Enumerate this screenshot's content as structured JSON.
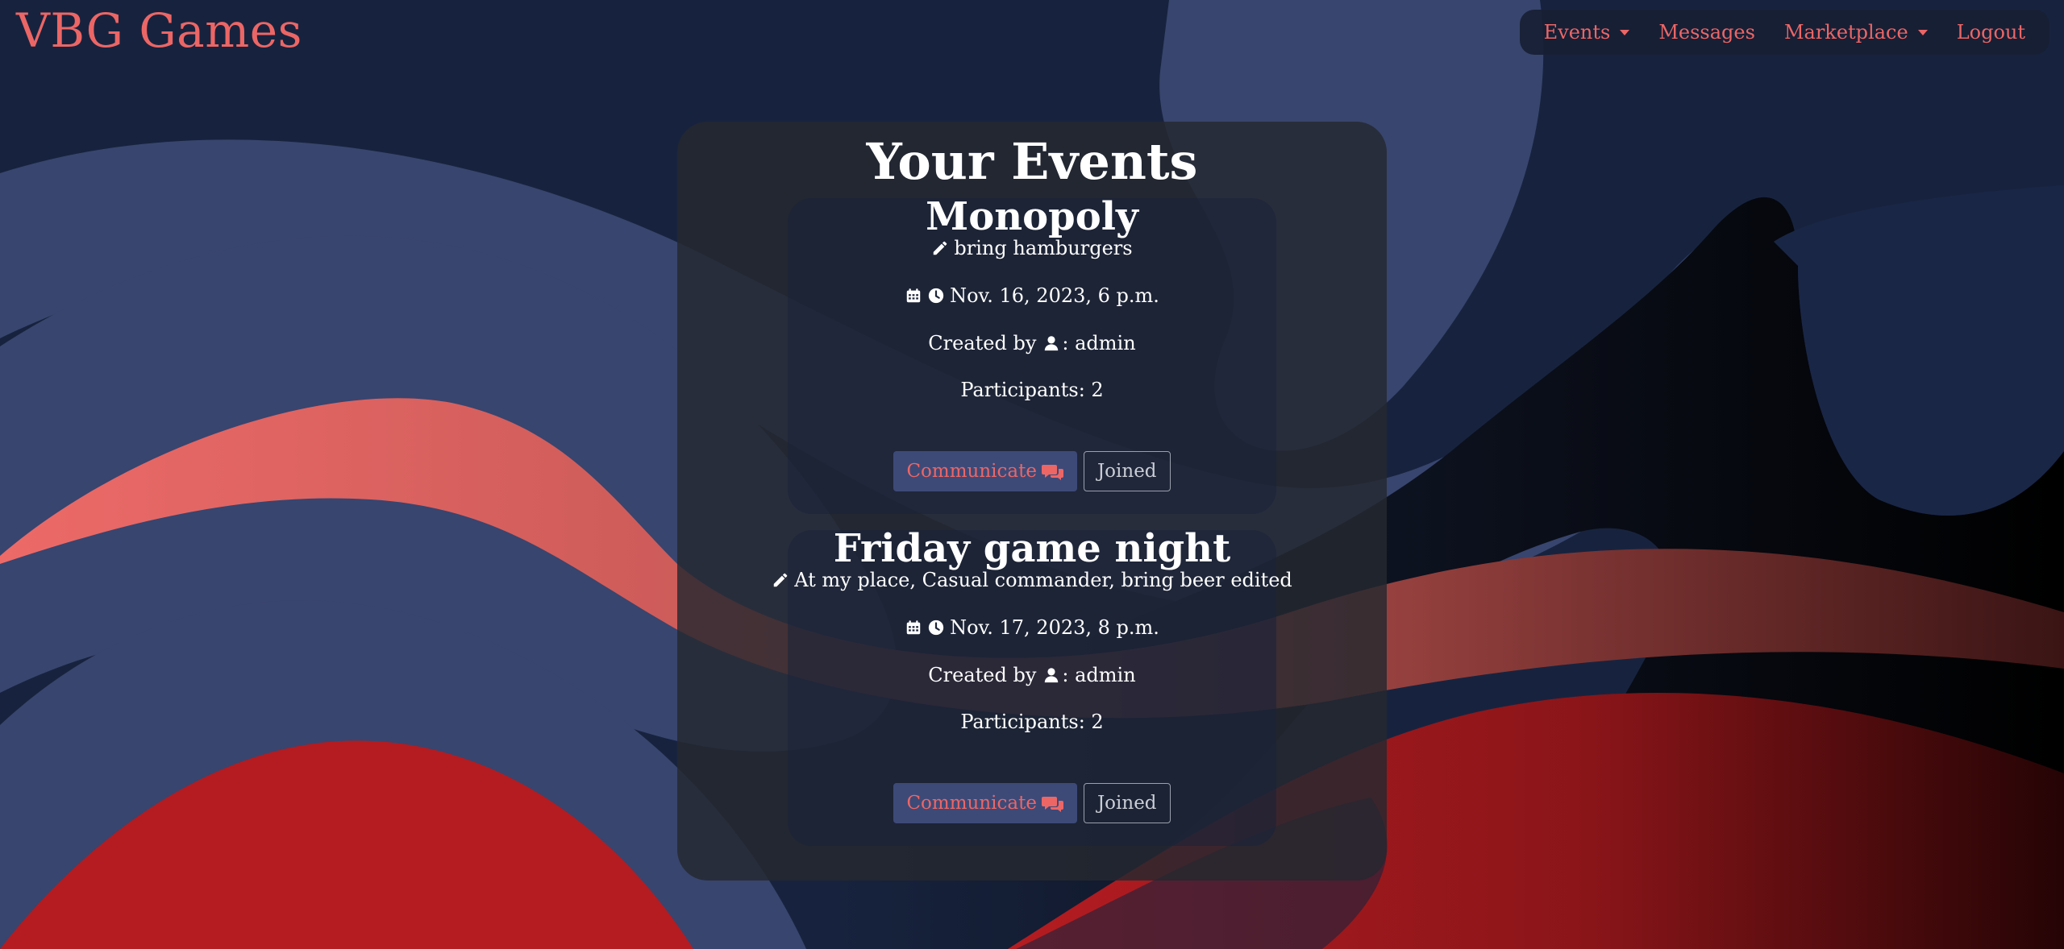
{
  "brand": "VBG Games",
  "nav": {
    "events": "Events",
    "messages": "Messages",
    "marketplace": "Marketplace",
    "logout": "Logout"
  },
  "page_title": "Your Events",
  "events": [
    {
      "title": "Monopoly",
      "description": "bring hamburgers",
      "datetime": "Nov. 16, 2023, 6 p.m.",
      "created_by_label": "Created by",
      "creator": ": admin",
      "participants": "Participants: 2",
      "communicate_label": "Communicate",
      "joined_label": "Joined"
    },
    {
      "title": "Friday game night",
      "description": "At my place, Casual commander, bring beer edited",
      "datetime": "Nov. 17, 2023, 8 p.m.",
      "created_by_label": "Created by",
      "creator": ": admin",
      "participants": "Participants: 2",
      "communicate_label": "Communicate",
      "joined_label": "Joined"
    }
  ],
  "icons": {
    "description": "pencil-icon",
    "date": "calendar-icon",
    "time": "clock-icon",
    "creator": "user-icon",
    "communicate": "comments-icon",
    "dropdown": "caret-down-icon"
  },
  "colors": {
    "accent": "#ec6666",
    "background": "#17233e",
    "wave_blue": "#38456e",
    "wave_red": "#b41c21",
    "button_bg": "#3d4a78"
  }
}
